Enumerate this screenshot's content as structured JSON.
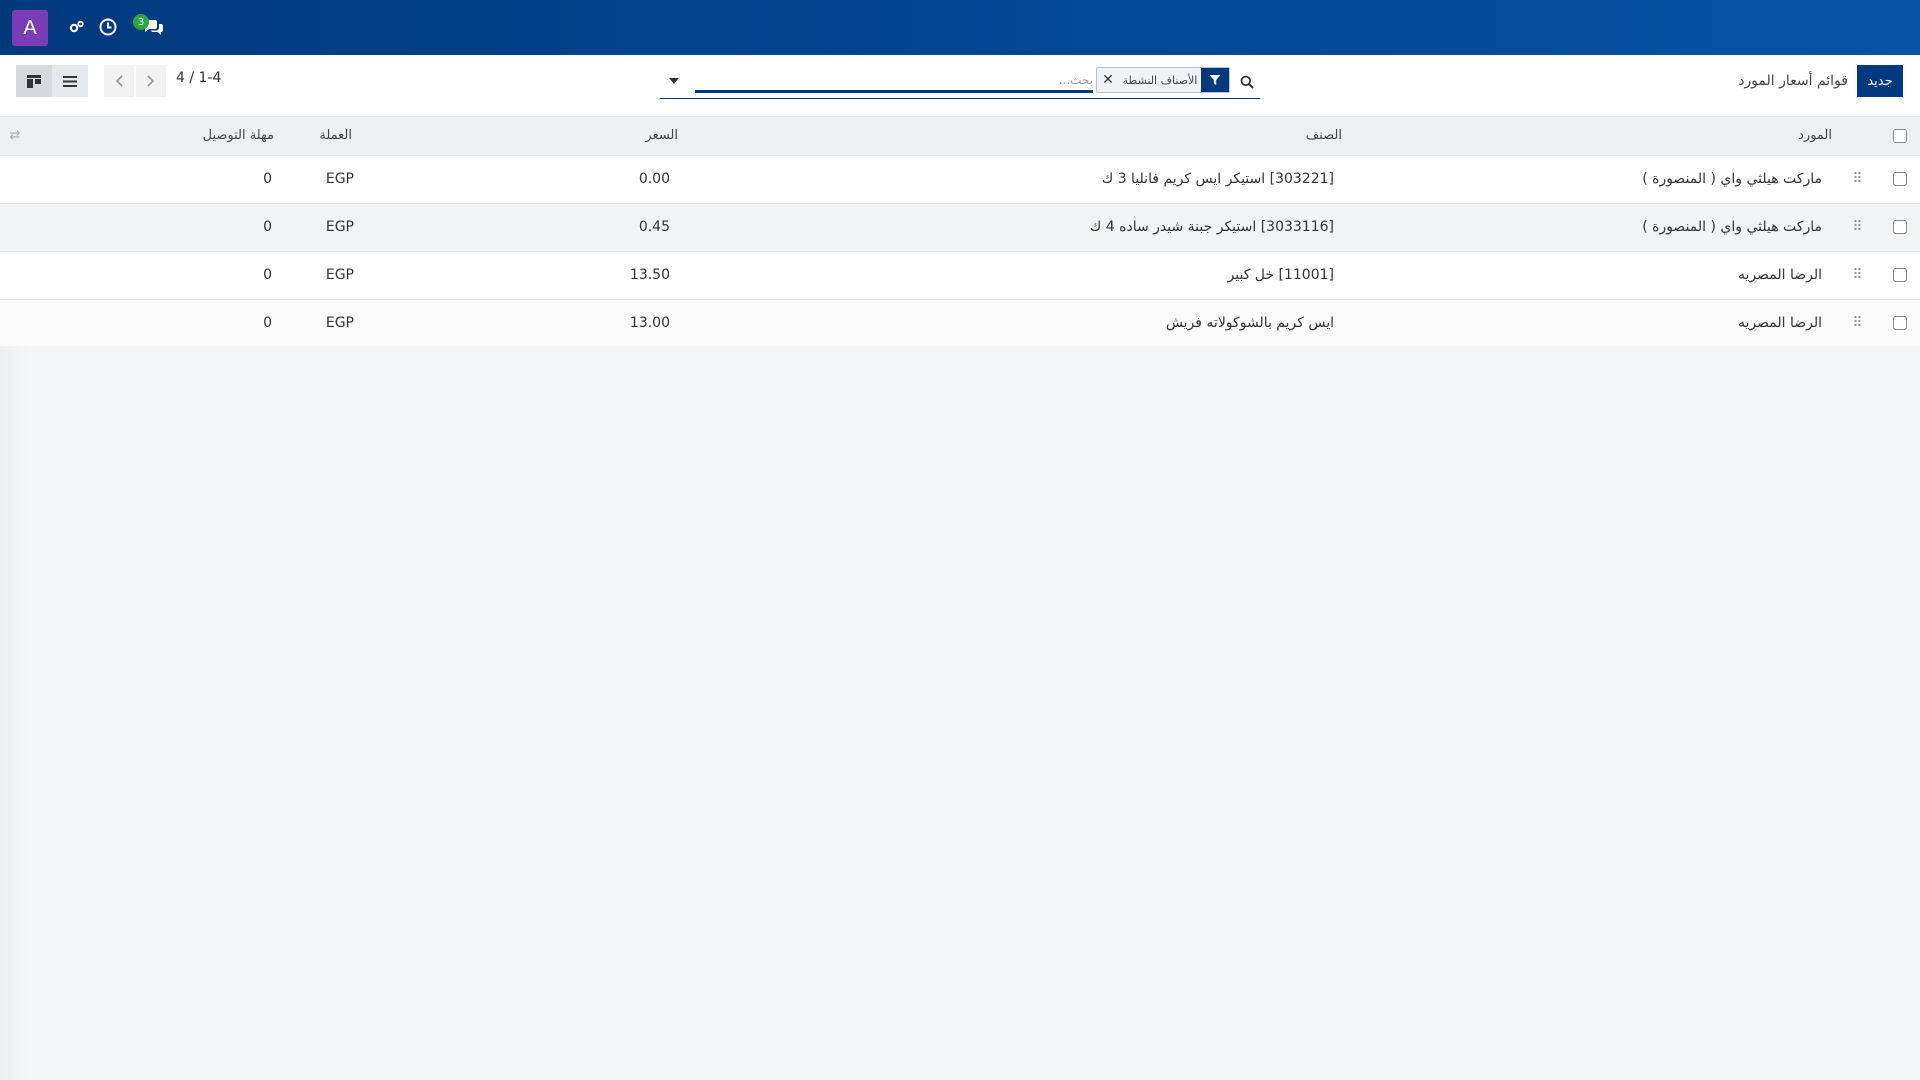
{
  "navbar": {
    "avatar_letter": "A",
    "icons": [
      "debug-icon",
      "clock-icon",
      "chat-icon"
    ],
    "chat_badge": "3",
    "colors": {
      "bar": "#01397f",
      "avatar": "#7b3db6",
      "badge": "#28a745"
    }
  },
  "control_panel": {
    "new_button": "جديد",
    "title": "قوائم أسعار المورد",
    "search": {
      "facet_label": "الأصناف النشطة",
      "placeholder": "بحث..."
    },
    "pager": "4 / 1-4"
  },
  "table": {
    "headers": {
      "vendor": "المورد",
      "product": "الصنف",
      "price": "السعر",
      "currency": "العملة",
      "delay": "مهلة التوصيل"
    },
    "rows": [
      {
        "vendor": "ماركت هيلثي واي ( المنصورة )",
        "product": "[303221] استيكر ايس كريم فانليا 3 ك",
        "price": "0.00",
        "currency": "EGP",
        "delay": "0"
      },
      {
        "vendor": "ماركت هيلثي واي ( المنصورة )",
        "product": "[3033116] استيكر جبنة شيدر ساده 4 ك",
        "price": "0.45",
        "currency": "EGP",
        "delay": "0"
      },
      {
        "vendor": "الرضا المصريه",
        "product": "[11001] خل كبير",
        "price": "13.50",
        "currency": "EGP",
        "delay": "0"
      },
      {
        "vendor": "الرضا المصريه",
        "product": "ايس كريم بالشوكولاته فريش",
        "price": "13.00",
        "currency": "EGP",
        "delay": "0"
      }
    ]
  }
}
